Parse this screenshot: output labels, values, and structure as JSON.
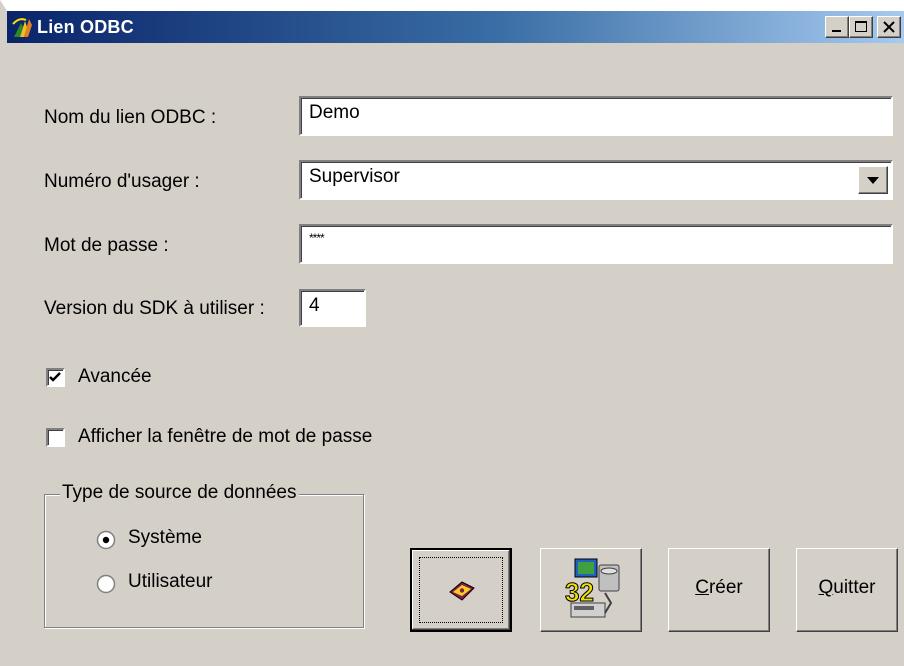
{
  "window": {
    "title": "Lien ODBC",
    "controls": [
      "minimize-icon",
      "maximize-icon",
      "close-icon"
    ]
  },
  "form": {
    "link_name": {
      "label": "Nom du lien ODBC :",
      "value": "Demo"
    },
    "user": {
      "label": "Numéro d'usager :",
      "value": "Supervisor"
    },
    "password": {
      "label": "Mot de passe :",
      "value": "****"
    },
    "sdk_version": {
      "label": "Version du SDK à utiliser :",
      "value": "4"
    },
    "advanced": {
      "label": "Avancée",
      "checked": true
    },
    "show_password_window": {
      "label": "Afficher la fenêtre de mot de passe",
      "checked": false
    }
  },
  "datasource_type": {
    "legend": "Type de source de données",
    "options": [
      {
        "label": "Système",
        "selected": true
      },
      {
        "label": "Utilisateur",
        "selected": false
      }
    ]
  },
  "buttons": {
    "help_icon": "help-book-icon",
    "odbc_admin_icon": "odbc-32-admin-icon",
    "create": {
      "mnemonic": "C",
      "rest": "réer"
    },
    "quit": {
      "mnemonic": "Q",
      "rest": "uitter"
    }
  },
  "colors": {
    "face": "#d4d0c8",
    "title_start": "#0a246a",
    "title_end": "#a6caf0"
  }
}
